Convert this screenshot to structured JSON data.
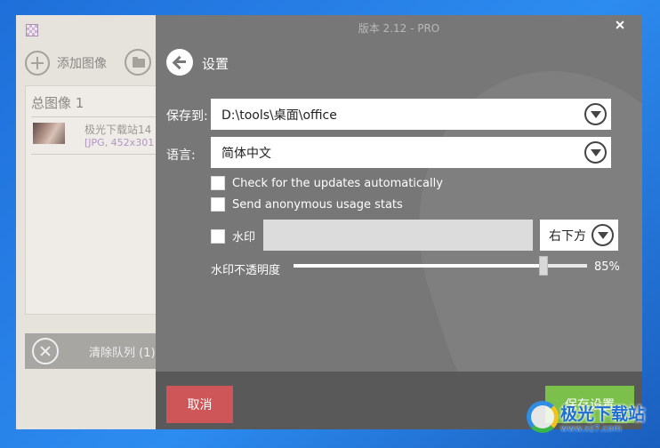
{
  "main_window": {
    "add_image_label": "添加图像",
    "total_images_label": "总图像 1",
    "queue_items": [
      {
        "name": "极光下载站14",
        "meta": "[JPG, 452x301"
      }
    ],
    "clear_queue_label": "清除队列 (1)"
  },
  "settings": {
    "version": "版本 2.12 - PRO",
    "title": "设置",
    "save_to_label": "保存到:",
    "save_to_value": "D:\\tools\\桌面\\office",
    "language_label": "语言:",
    "language_value": "简体中文",
    "check_updates_label": "Check for the updates automatically",
    "anonymous_stats_label": "Send anonymous usage stats",
    "watermark_label": "水印",
    "watermark_text": "",
    "watermark_position": "右下方",
    "watermark_opacity_label": "水印不透明度",
    "watermark_opacity_value": "85%",
    "watermark_opacity_fraction": 0.85,
    "cancel_label": "取消",
    "save_label": "保存设置"
  },
  "watermark_logo": {
    "name": "极光下载站",
    "url": "www.xz7.com"
  },
  "colors": {
    "cancel": "#cf5658",
    "save": "#7bc04a",
    "overlay": "#777777"
  }
}
